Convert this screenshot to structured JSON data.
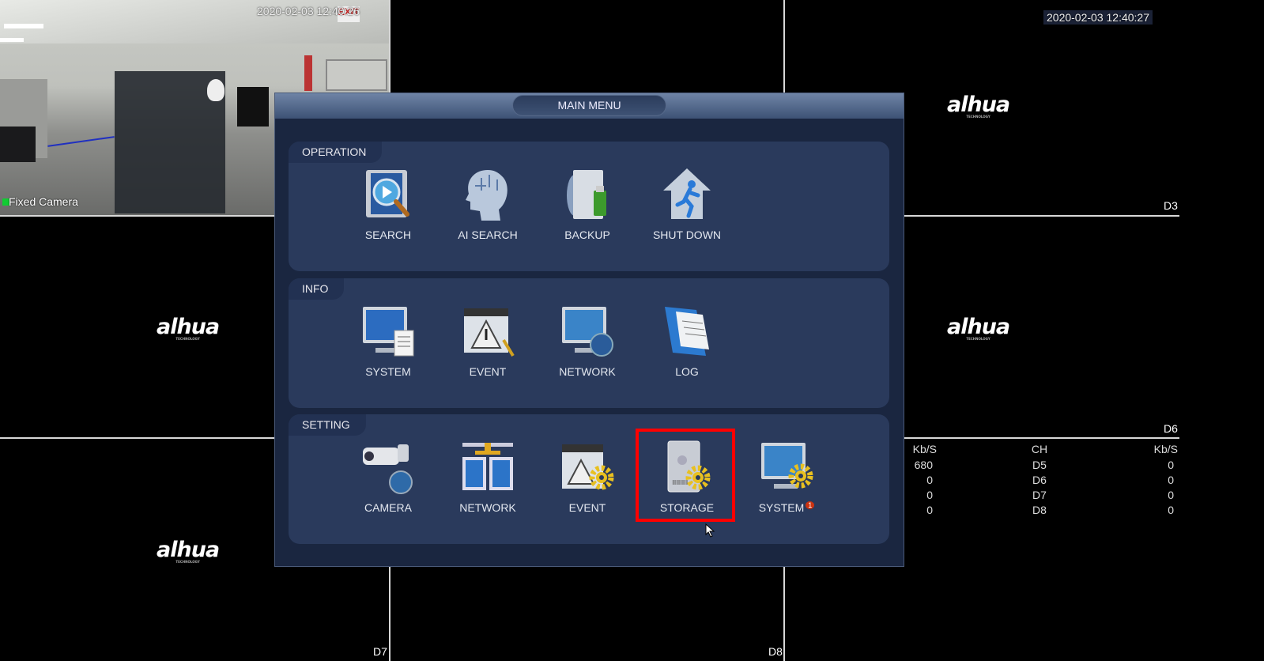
{
  "camera_feed": {
    "timestamp": "2020-02-03 12:40:26",
    "name": "Fixed Camera",
    "exit_sign": "EXIT"
  },
  "top_right_timestamp": "2020-02-03 12:40:27",
  "channel_labels": {
    "d3": "D3",
    "d6": "D6",
    "d7": "D7",
    "d8": "D8"
  },
  "logo": {
    "text": "alhua",
    "sub": "TECHNOLOGY"
  },
  "bitrate_table": {
    "headers": [
      "Kb/S",
      "CH",
      "Kb/S"
    ],
    "rows": [
      [
        "680",
        "D5",
        "0"
      ],
      [
        "0",
        "D6",
        "0"
      ],
      [
        "0",
        "D7",
        "0"
      ],
      [
        "0",
        "D8",
        "0"
      ]
    ]
  },
  "main_menu": {
    "title": "MAIN MENU",
    "sections": [
      {
        "label": "OPERATION",
        "items": [
          {
            "label": "SEARCH",
            "icon": "film-search-icon"
          },
          {
            "label": "AI SEARCH",
            "icon": "ai-head-icon"
          },
          {
            "label": "BACKUP",
            "icon": "backup-usb-icon"
          },
          {
            "label": "SHUT DOWN",
            "icon": "exit-house-icon"
          }
        ]
      },
      {
        "label": "INFO",
        "items": [
          {
            "label": "SYSTEM",
            "icon": "monitor-document-icon"
          },
          {
            "label": "EVENT",
            "icon": "event-warning-icon"
          },
          {
            "label": "NETWORK",
            "icon": "monitor-globe-icon"
          },
          {
            "label": "LOG",
            "icon": "log-book-icon"
          }
        ]
      },
      {
        "label": "SETTING",
        "items": [
          {
            "label": "CAMERA",
            "icon": "camera-globe-icon"
          },
          {
            "label": "NETWORK",
            "icon": "network-icon"
          },
          {
            "label": "EVENT",
            "icon": "event-gear-icon"
          },
          {
            "label": "STORAGE",
            "icon": "hdd-gear-icon"
          },
          {
            "label": "SYSTEM",
            "icon": "monitor-gear-icon",
            "badge": "1"
          }
        ]
      }
    ],
    "highlighted": "STORAGE"
  },
  "colors": {
    "menu_bg": "#1a2640",
    "section_bg": "#2a3a5c",
    "highlight": "#ff0000"
  }
}
